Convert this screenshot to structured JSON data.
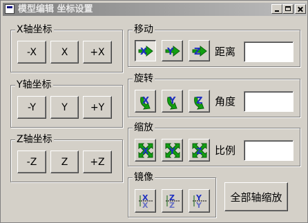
{
  "window": {
    "title": "模型编辑 坐标设置",
    "controls": {
      "minimize_icon": "minimize-icon",
      "maximize_icon": "maximize-icon",
      "close_icon": "close-icon"
    }
  },
  "axis_groups": [
    {
      "label": "X轴坐标",
      "buttons": [
        "-X",
        "X",
        "+X"
      ]
    },
    {
      "label": "Y轴坐标",
      "buttons": [
        "-Y",
        "Y",
        "+Y"
      ]
    },
    {
      "label": "Z轴坐标",
      "buttons": [
        "-Z",
        "Z",
        "+Z"
      ]
    }
  ],
  "move": {
    "label": "移动",
    "param_label": "距离",
    "value": "",
    "icons": [
      "move-x-icon",
      "move-y-icon",
      "move-z-icon"
    ]
  },
  "rotate": {
    "label": "旋转",
    "param_label": "角度",
    "value": "",
    "icons": [
      "rotate-x-icon",
      "rotate-y-icon",
      "rotate-z-icon"
    ]
  },
  "scale": {
    "label": "缩放",
    "param_label": "比例",
    "value": "",
    "icons": [
      "scale-x-icon",
      "scale-y-icon",
      "scale-z-icon"
    ]
  },
  "mirror": {
    "label": "镜像",
    "icons": [
      "mirror-x-icon",
      "mirror-z-icon",
      "mirror-y-icon"
    ]
  },
  "scale_all_label": "全部轴缩放",
  "colors": {
    "icon_green": "#12a012",
    "icon_blue": "#1e2fc0",
    "face": "#d4d0c8"
  }
}
